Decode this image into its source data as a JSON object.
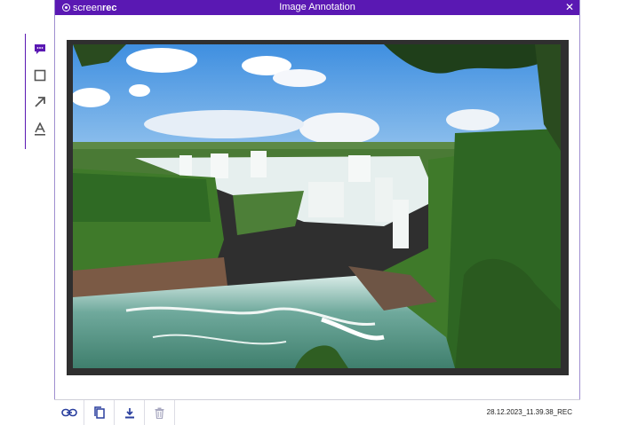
{
  "titlebar": {
    "brand_prefix": "screen",
    "brand_suffix": "rec",
    "title": "Image Annotation",
    "close_glyph": "✕"
  },
  "tools": [
    {
      "name": "comment-tool",
      "icon": "speech-bubble-icon",
      "active": true
    },
    {
      "name": "rectangle-tool",
      "icon": "square-icon",
      "active": false
    },
    {
      "name": "arrow-tool",
      "icon": "arrow-icon",
      "active": false
    },
    {
      "name": "text-tool",
      "icon": "text-icon",
      "active": false
    }
  ],
  "bottom_actions": [
    {
      "name": "copy-link-button",
      "icon": "link-icon"
    },
    {
      "name": "copy-button",
      "icon": "copy-icon"
    },
    {
      "name": "download-button",
      "icon": "download-icon"
    },
    {
      "name": "delete-button",
      "icon": "trash-icon"
    }
  ],
  "filename": "28.12.2023_11.39.38_REC",
  "colors": {
    "accent": "#5a18b3",
    "icon_blue": "#2a3f9e",
    "icon_gray": "#555555",
    "trash_muted": "#a8a8c0"
  }
}
